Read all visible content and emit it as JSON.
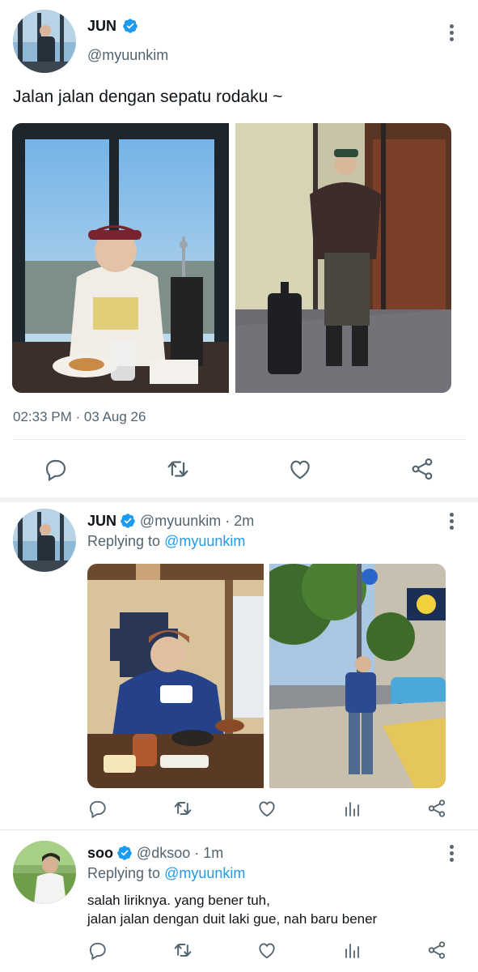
{
  "main_tweet": {
    "name": "JUN",
    "handle": "@myuunkim",
    "text": "Jalan jalan dengan sepatu rodaku ~",
    "timestamp": "02:33 PM · 03 Aug 26",
    "photos": [
      "hotel-window-breakfast",
      "mirror-selfie-luggage"
    ]
  },
  "reply_1": {
    "name": "JUN",
    "handle_time": "@myuunkim · 2m",
    "replying_prefix": "Replying to",
    "replying_to": "@myuunkim",
    "photos": [
      "japanese-meal",
      "street-portrait"
    ]
  },
  "reply_2": {
    "name": "soo",
    "handle_time": "@dksoo · 1m",
    "replying_prefix": "Replying to",
    "replying_to": "@myuunkim",
    "text_line1": "salah liriknya. yang bener tuh,",
    "text_line2": "jalan jalan dengan duit laki gue, nah baru bener"
  },
  "icons": [
    "verified-badge-icon",
    "more-options-icon",
    "reply-icon",
    "retweet-icon",
    "like-icon",
    "analytics-icon",
    "share-icon"
  ],
  "colors": {
    "accent": "#1d9bf0",
    "text": "#0f1419",
    "muted": "#536471",
    "icon": "#536471"
  }
}
